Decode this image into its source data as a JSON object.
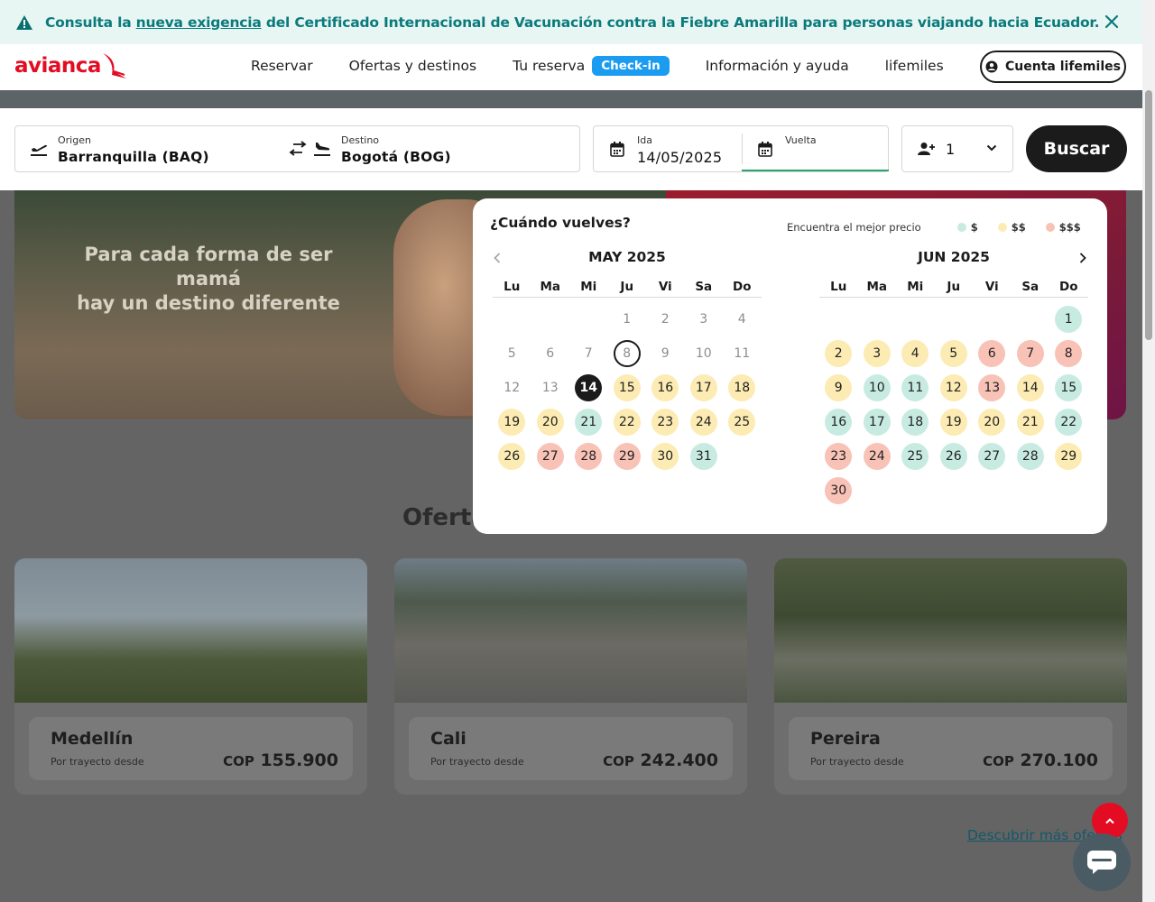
{
  "alert": {
    "before": "Consulta la ",
    "link": "nueva exigencia",
    "after": " del Certificado Internacional de Vacunación contra la Fiebre Amarilla para personas viajando hacia Ecuador."
  },
  "header": {
    "logo": "avianca",
    "nav": [
      "Reservar",
      "Ofertas y destinos",
      "Tu reserva",
      "Información y ayuda",
      "lifemiles"
    ],
    "checkin_badge": "Check-in",
    "account_button": "Cuenta lifemiles"
  },
  "search": {
    "origin_label": "Origen",
    "origin_value": "Barranquilla  (BAQ)",
    "destination_label": "Destino",
    "destination_value": "Bogotá  (BOG)",
    "departure_label": "Ida",
    "departure_value": "14/05/2025",
    "return_label": "Vuelta",
    "return_value": "",
    "passengers": "1",
    "search_button": "Buscar"
  },
  "hero": {
    "tagline_line1": "Para cada forma de ser mamá",
    "tagline_line2": "hay un destino diferente"
  },
  "offers": {
    "title": "Ofertas",
    "cards": [
      {
        "city": "Medellín",
        "sub": "Por trayecto desde",
        "currency": "COP",
        "price": "155.900"
      },
      {
        "city": "Cali",
        "sub": "Por trayecto desde",
        "currency": "COP",
        "price": "242.400"
      },
      {
        "city": "Pereira",
        "sub": "Por trayecto desde",
        "currency": "COP",
        "price": "270.100"
      }
    ],
    "more_link": "Descubrir más ofertas"
  },
  "calendar": {
    "question": "¿Cuándo vuelves?",
    "legend_title": "Encuentra el mejor precio",
    "legend": [
      {
        "label": "$",
        "color": "#c8ebe1"
      },
      {
        "label": "$$",
        "color": "#fcebb2"
      },
      {
        "label": "$$$",
        "color": "#f8c2b6"
      }
    ],
    "weekdays": [
      "Lu",
      "Ma",
      "Mi",
      "Ju",
      "Vi",
      "Sa",
      "Do"
    ],
    "months": [
      {
        "title": "MAY 2025",
        "offset": 3,
        "days": [
          {
            "d": "1",
            "s": "dis"
          },
          {
            "d": "2",
            "s": "dis"
          },
          {
            "d": "3",
            "s": "dis"
          },
          {
            "d": "4",
            "s": "dis"
          },
          {
            "d": "5",
            "s": "dis"
          },
          {
            "d": "6",
            "s": "dis"
          },
          {
            "d": "7",
            "s": "dis"
          },
          {
            "d": "8",
            "s": "today"
          },
          {
            "d": "9",
            "s": "dis"
          },
          {
            "d": "10",
            "s": "dis"
          },
          {
            "d": "11",
            "s": "dis"
          },
          {
            "d": "12",
            "s": "dis"
          },
          {
            "d": "13",
            "s": "dis"
          },
          {
            "d": "14",
            "s": "sel"
          },
          {
            "d": "15",
            "s": "p2"
          },
          {
            "d": "16",
            "s": "p2"
          },
          {
            "d": "17",
            "s": "p2"
          },
          {
            "d": "18",
            "s": "p2"
          },
          {
            "d": "19",
            "s": "p2"
          },
          {
            "d": "20",
            "s": "p2"
          },
          {
            "d": "21",
            "s": "p1"
          },
          {
            "d": "22",
            "s": "p2"
          },
          {
            "d": "23",
            "s": "p2"
          },
          {
            "d": "24",
            "s": "p2"
          },
          {
            "d": "25",
            "s": "p2"
          },
          {
            "d": "26",
            "s": "p2"
          },
          {
            "d": "27",
            "s": "p3"
          },
          {
            "d": "28",
            "s": "p3"
          },
          {
            "d": "29",
            "s": "p3"
          },
          {
            "d": "30",
            "s": "p2"
          },
          {
            "d": "31",
            "s": "p1"
          }
        ]
      },
      {
        "title": "JUN 2025",
        "offset": 6,
        "days": [
          {
            "d": "1",
            "s": "p1"
          },
          {
            "d": "2",
            "s": "p2"
          },
          {
            "d": "3",
            "s": "p2"
          },
          {
            "d": "4",
            "s": "p2"
          },
          {
            "d": "5",
            "s": "p2"
          },
          {
            "d": "6",
            "s": "p3"
          },
          {
            "d": "7",
            "s": "p3"
          },
          {
            "d": "8",
            "s": "p3"
          },
          {
            "d": "9",
            "s": "p2"
          },
          {
            "d": "10",
            "s": "p1"
          },
          {
            "d": "11",
            "s": "p1"
          },
          {
            "d": "12",
            "s": "p2"
          },
          {
            "d": "13",
            "s": "p3"
          },
          {
            "d": "14",
            "s": "p2"
          },
          {
            "d": "15",
            "s": "p1"
          },
          {
            "d": "16",
            "s": "p1"
          },
          {
            "d": "17",
            "s": "p1"
          },
          {
            "d": "18",
            "s": "p1"
          },
          {
            "d": "19",
            "s": "p2"
          },
          {
            "d": "20",
            "s": "p2"
          },
          {
            "d": "21",
            "s": "p2"
          },
          {
            "d": "22",
            "s": "p1"
          },
          {
            "d": "23",
            "s": "p3"
          },
          {
            "d": "24",
            "s": "p3"
          },
          {
            "d": "25",
            "s": "p1"
          },
          {
            "d": "26",
            "s": "p1"
          },
          {
            "d": "27",
            "s": "p1"
          },
          {
            "d": "28",
            "s": "p1"
          },
          {
            "d": "29",
            "s": "p2"
          },
          {
            "d": "30",
            "s": "p3"
          }
        ]
      }
    ]
  },
  "colors": {
    "brand_red": "#e40c22",
    "alert_teal": "#0a7a7c",
    "checkin_blue": "#1b9cf0"
  },
  "icons": [
    "warning-icon",
    "close-icon",
    "user-icon",
    "takeoff-icon",
    "swap-icon",
    "landing-icon",
    "calendar-icon",
    "add-passenger-icon",
    "chevron-down-icon",
    "chevron-left-icon",
    "chevron-right-icon",
    "arrow-up-icon",
    "chat-icon"
  ]
}
